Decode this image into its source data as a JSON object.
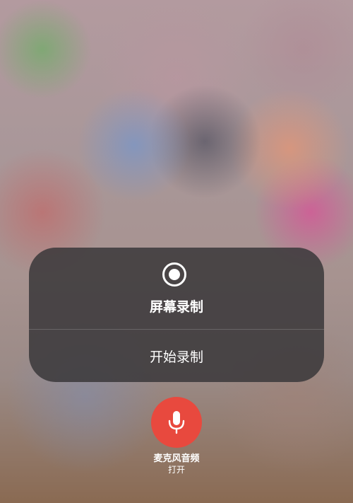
{
  "panel": {
    "title": "屏幕录制",
    "start_button_label": "开始录制",
    "record_icon": "record-icon"
  },
  "microphone": {
    "label": "麦克风音频",
    "status": "打开",
    "icon": "microphone-icon",
    "accent_color": "#e8493e"
  }
}
